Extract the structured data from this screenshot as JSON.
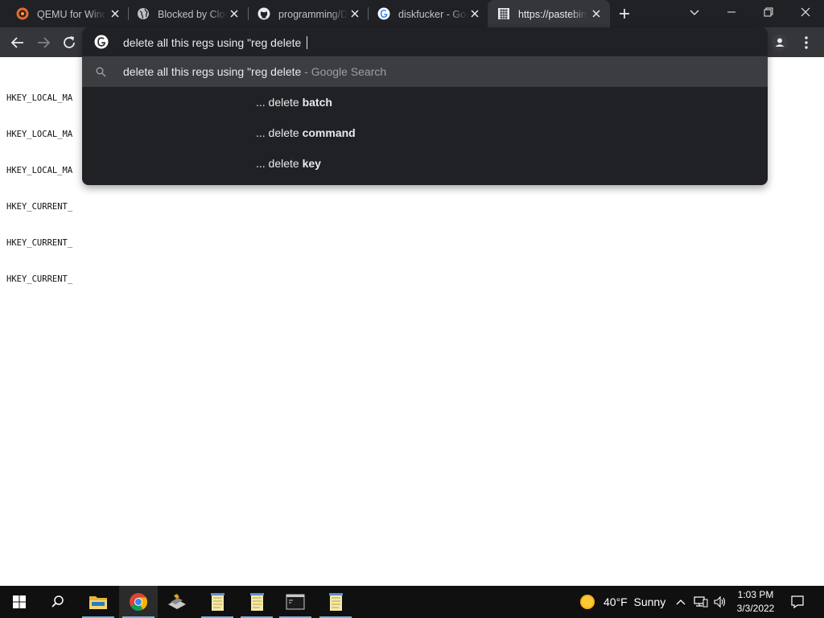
{
  "tabs": [
    {
      "title": "QEMU for Windows",
      "icon": "qemu-icon",
      "active": false
    },
    {
      "title": "Blocked by Cloudflare",
      "icon": "globe-icon",
      "active": false
    },
    {
      "title": "programming/D",
      "icon": "github-icon",
      "active": false
    },
    {
      "title": "diskfucker - Google",
      "icon": "google-icon",
      "active": false
    },
    {
      "title": "https://pastebin",
      "icon": "pastebin-icon",
      "active": true
    }
  ],
  "omnibox": {
    "input": "delete all this regs using \"reg delete ",
    "suggestions": [
      {
        "main": "delete all this regs using \"reg delete",
        "suffix": " - Google Search",
        "type": "search"
      },
      {
        "prefix": "... delete ",
        "bold": "batch",
        "type": "completion"
      },
      {
        "prefix": "... delete ",
        "bold": "command",
        "type": "completion"
      },
      {
        "prefix": "... delete ",
        "bold": "key",
        "type": "completion"
      }
    ]
  },
  "page": {
    "lines": [
      "HKEY_LOCAL_MA",
      "HKEY_LOCAL_MA",
      "HKEY_LOCAL_MA",
      "HKEY_CURRENT_",
      "HKEY_CURRENT_",
      "HKEY_CURRENT_"
    ]
  },
  "taskbar": {
    "apps": [
      "start-icon",
      "search-icon",
      "file-explorer-icon",
      "chrome-icon",
      "app-icon",
      "notepad-icon",
      "notepad-icon",
      "terminal-icon",
      "notepad-icon"
    ],
    "weather": {
      "temp": "40°F",
      "condition": "Sunny"
    },
    "time": "1:03 PM",
    "date": "3/3/2022"
  },
  "colors": {
    "tabstrip": "#202124",
    "toolbar": "#35363a",
    "dropdown": "#202124",
    "taskbar": "#101010"
  }
}
